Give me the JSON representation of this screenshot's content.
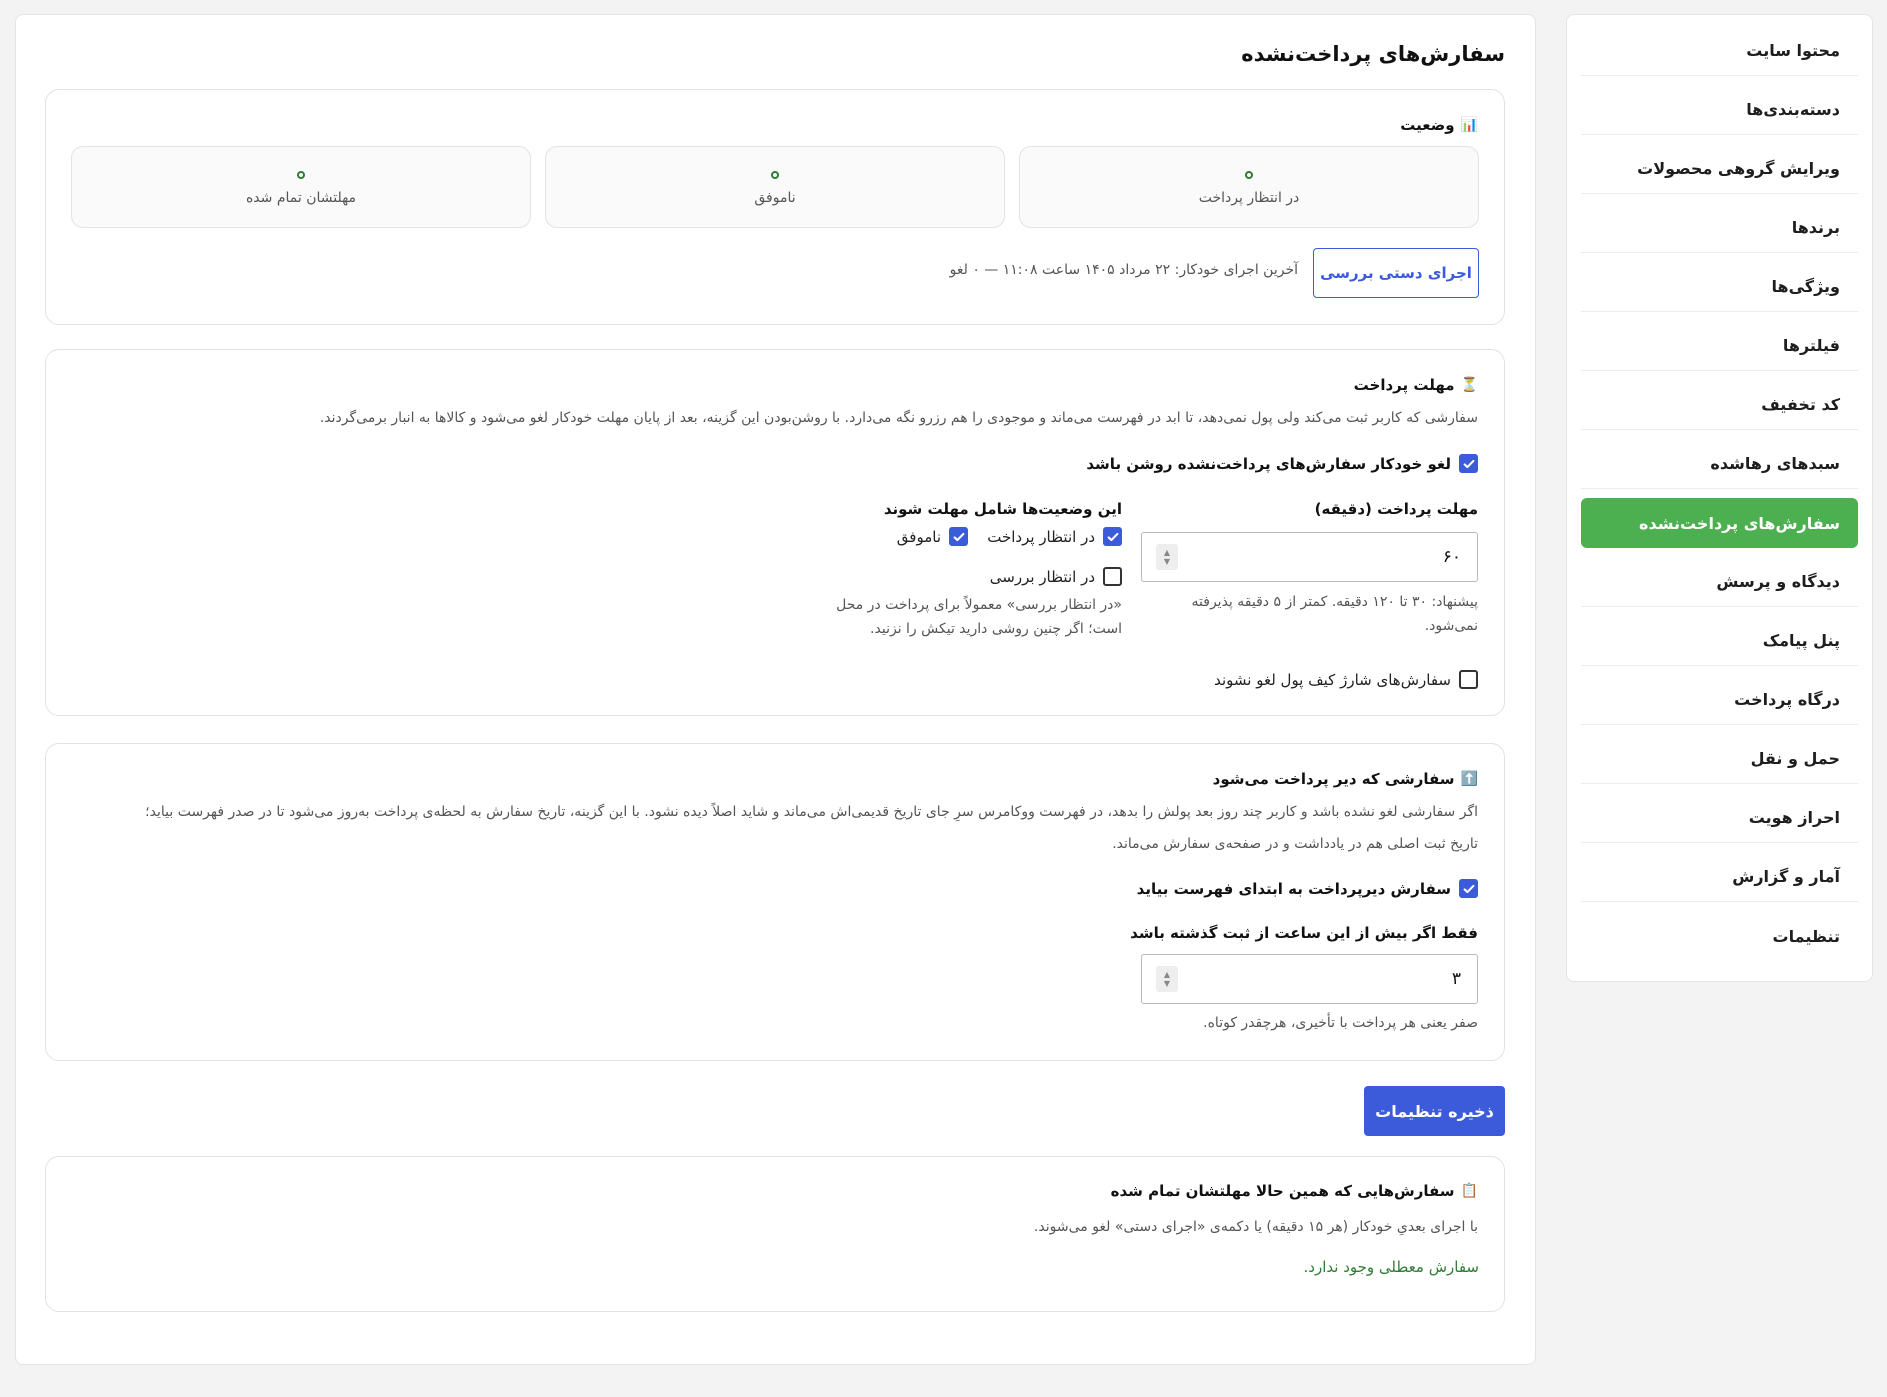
{
  "sidebar": {
    "items": [
      {
        "label": "محتوا سایت"
      },
      {
        "label": "دسته‌بندی‌ها"
      },
      {
        "label": "ویرایش گروهی محصولات"
      },
      {
        "label": "برندها"
      },
      {
        "label": "ویژگی‌ها"
      },
      {
        "label": "فیلترها"
      },
      {
        "label": "کد تخفیف"
      },
      {
        "label": "سبدهای رهاشده"
      },
      {
        "label": "سفارش‌های پرداخت‌نشده"
      },
      {
        "label": "دیدگاه و پرسش"
      },
      {
        "label": "پنل پیامک"
      },
      {
        "label": "درگاه پرداخت"
      },
      {
        "label": "حمل و نقل"
      },
      {
        "label": "احراز هویت"
      },
      {
        "label": "آمار و گزارش"
      },
      {
        "label": "تنظیمات"
      }
    ],
    "active_index": 8
  },
  "page": {
    "title": "سفارش‌های پرداخت‌نشده"
  },
  "status_card": {
    "icon": "📊",
    "title": "وضعیت",
    "boxes": [
      {
        "label": "در انتظار پرداخت"
      },
      {
        "label": "ناموفق"
      },
      {
        "label": "مهلتشان تمام شده"
      }
    ],
    "manual_run_label": "اجرای دستی بررسی",
    "last_run_text": "آخرین اجرای خودکار: ۲۲ مرداد ۱۴۰۵ ساعت ۱۱:۰۸ — ۰ لغو"
  },
  "deadline_card": {
    "icon": "⏳",
    "title": "مهلت پرداخت",
    "description": "سفارشی که کاربر ثبت می‌کند ولی پول نمی‌دهد، تا ابد در فهرست می‌ماند و موجودی را هم رزرو نگه می‌دارد. با روشن‌بودن این گزینه، بعد از پایان مهلت خودکار لغو می‌شود و کالاها به انبار برمی‌گردند.",
    "auto_cancel_label": "لغو خودکار سفارش‌های پرداخت‌نشده روشن باشد",
    "auto_cancel_checked": true,
    "deadline_label": "مهلت پرداخت (دقیقه)",
    "deadline_value": "۶۰",
    "deadline_hint": "پیشنهاد: ۳۰ تا ۱۲۰ دقیقه. کمتر از ۵ دقیقه پذیرفته نمی‌شود.",
    "statuses_label": "این وضعیت‌ها شامل مهلت شوند",
    "statuses": [
      {
        "label": "در انتظار پرداخت",
        "checked": true
      },
      {
        "label": "ناموفق",
        "checked": true
      },
      {
        "label": "در انتظار بررسی",
        "checked": false
      }
    ],
    "review_note": "«در انتظار بررسی» معمولاً برای پرداخت در محل است؛ اگر چنین روشی دارید تیکش را نزنید.",
    "wallet_label": "سفارش‌های شارژ کیف پول لغو نشوند",
    "wallet_checked": false
  },
  "late_card": {
    "icon": "⬆️",
    "title": "سفارشی که دیر پرداخت می‌شود",
    "description_line1": "اگر سفارشی لغو نشده باشد و کاربر چند روز بعد پولش را بدهد، در فهرست ووکامرس سرِ جای تاریخ قدیمی‌اش می‌ماند و شاید اصلاً دیده نشود. با این گزینه، تاریخ سفارش به لحظه‌ی پرداخت به‌روز می‌شود تا در صدر فهرست بیاید؛",
    "description_line2": "تاریخ ثبت اصلی هم در یادداشت و در صفحه‌ی سفارش می‌ماند.",
    "bump_label": "سفارش دیرپرداخت به ابتدای فهرست بیاید",
    "bump_checked": true,
    "hours_label": "فقط اگر بیش از این ساعت از ثبت گذشته باشد",
    "hours_value": "۳",
    "hours_hint": "صفر یعنی هر پرداخت با تأخیری، هرچقدر کوتاه."
  },
  "save_label": "ذخیره تنظیمات",
  "expired_card": {
    "icon": "📋",
    "title": "سفارش‌هایی که همین حالا مهلتشان تمام شده",
    "description": "با اجرای بعدیِ خودکار (هر ۱۵ دقیقه) یا دکمه‌ی «اجرای دستی» لغو می‌شوند.",
    "empty_message": "سفارش معطلی وجود ندارد."
  },
  "colors": {
    "accent": "#3b5bdb",
    "active_nav": "#4caf50",
    "success_text": "#2e7d32"
  }
}
